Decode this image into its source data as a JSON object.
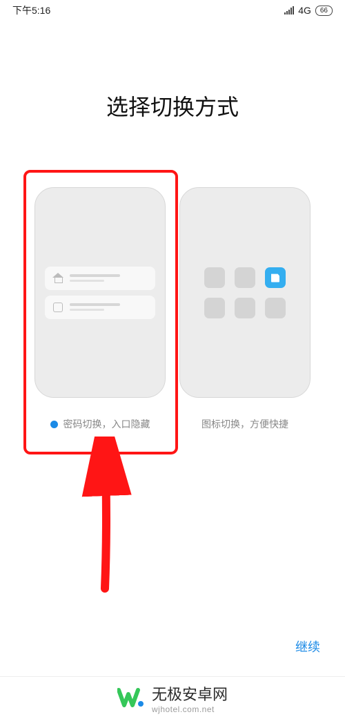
{
  "status": {
    "time": "下午5:16",
    "network": "4G",
    "battery": "66"
  },
  "title": "选择切换方式",
  "options": [
    {
      "label": "密码切换，入口隐藏",
      "selected": true
    },
    {
      "label": "图标切换，方便快捷",
      "selected": false
    }
  ],
  "continue": "继续",
  "watermark": {
    "name": "无极安卓网",
    "url": "wjhotel.com.net"
  },
  "annotation": {
    "highlight_color": "#ff1515",
    "arrow_color": "#ff1515"
  }
}
